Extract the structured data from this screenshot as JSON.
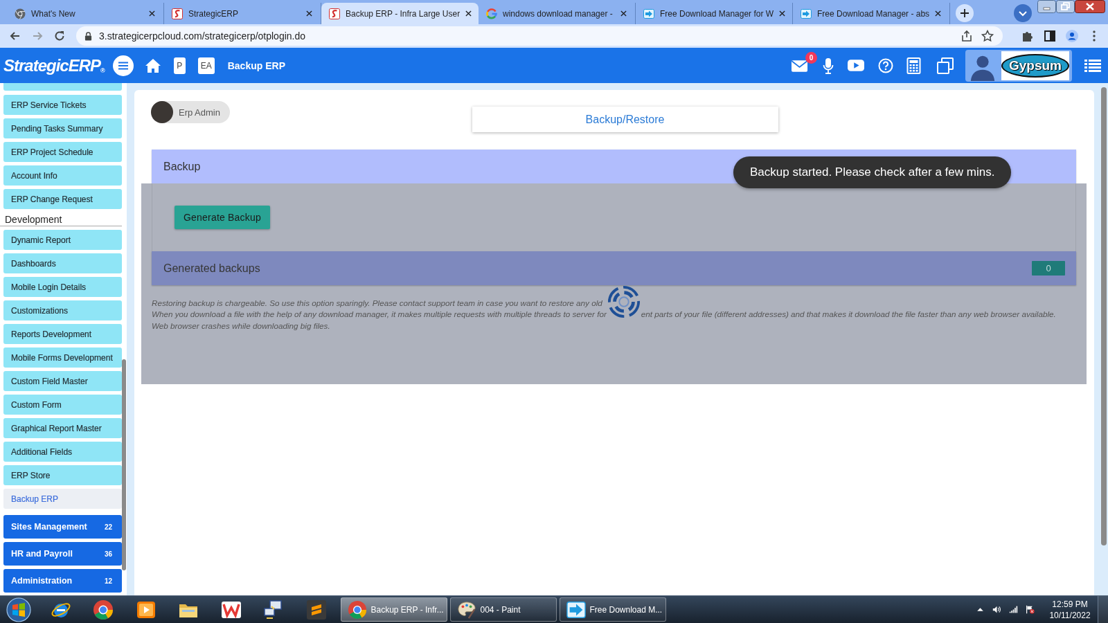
{
  "browser": {
    "tabs": [
      {
        "title": "What's New",
        "kind": "chrome",
        "selected": false
      },
      {
        "title": "StrategicERP",
        "kind": "erp",
        "selected": false
      },
      {
        "title": "Backup ERP - Infra Large User",
        "kind": "erp",
        "selected": true
      },
      {
        "title": "windows download manager -",
        "kind": "google",
        "selected": false
      },
      {
        "title": "Free Download Manager for W",
        "kind": "download",
        "selected": false
      },
      {
        "title": "Free Download Manager - abs",
        "kind": "download",
        "selected": false
      }
    ],
    "address": "3.strategicerpcloud.com/strategicerp/otplogin.do"
  },
  "app_header": {
    "logo": "StrategicERP",
    "logo_mark": "®",
    "shortcuts": [
      "P",
      "EA"
    ],
    "title": "Backup ERP",
    "mail_count": "0",
    "brand": "Gypsum"
  },
  "sidebar": {
    "items": [
      {
        "label": "ERP Service Tickets",
        "selected": false
      },
      {
        "label": "Pending Tasks Summary",
        "selected": false
      },
      {
        "label": "ERP Project Schedule",
        "selected": false
      },
      {
        "label": "Account Info",
        "selected": false
      },
      {
        "label": "ERP Change Request",
        "selected": false
      }
    ],
    "section": {
      "heading": "Development",
      "items": [
        {
          "label": "Dynamic Report",
          "selected": false
        },
        {
          "label": "Dashboards",
          "selected": false
        },
        {
          "label": "Mobile Login Details",
          "selected": false
        },
        {
          "label": "Customizations",
          "selected": false
        },
        {
          "label": "Reports Development",
          "selected": false
        },
        {
          "label": "Mobile Forms Development",
          "selected": false
        },
        {
          "label": "Custom Field Master",
          "selected": false
        },
        {
          "label": "Custom Form",
          "selected": false
        },
        {
          "label": "Graphical Report Master",
          "selected": false
        },
        {
          "label": "Additional Fields",
          "selected": false
        },
        {
          "label": "ERP Store",
          "selected": false
        },
        {
          "label": "Backup ERP",
          "selected": true
        }
      ]
    },
    "modules": [
      {
        "label": "Sites Management",
        "count": "22",
        "selected": false
      },
      {
        "label": "HR and Payroll",
        "count": "36",
        "selected": false
      },
      {
        "label": "Administration",
        "count": "12",
        "selected": false
      }
    ]
  },
  "main": {
    "user": "Erp Admin",
    "page_title": "Backup/Restore",
    "backup_panel": {
      "title": "Backup",
      "action": "Generate Backup"
    },
    "generated_panel": {
      "title": "Generated backups",
      "count": "0"
    },
    "notes": [
      [
        "Restoring backup is chargeable. So use this option sparingly. Please contact support team in case you want to restore any old"
      ],
      [
        "When you download a file with the help of any download manager, it makes multiple requests with multiple threads to server for",
        "ent parts of your file (different addresses) and that makes it download the file faster than any web browser available."
      ],
      [
        "Web browser crashes while downloading big files."
      ]
    ],
    "loading": true,
    "toast": "Backup started. Please check after a few mins."
  },
  "taskbar": {
    "tasks": [
      {
        "title": "Backup ERP - Infr...",
        "kind": "chrome",
        "selected": true
      },
      {
        "title": "004 - Paint",
        "kind": "paint",
        "selected": false
      },
      {
        "title": "Free Download M...",
        "kind": "download",
        "selected": false
      }
    ],
    "time": "12:59 PM",
    "date": "10/11/2022"
  }
}
